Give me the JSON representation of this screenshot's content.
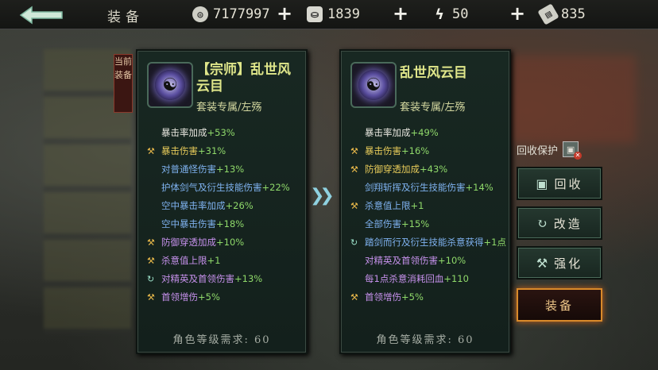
{
  "header": {
    "title": "装备",
    "resources": [
      {
        "icon": "coin-icon",
        "value": "7177997"
      },
      {
        "icon": "silver-ingot-icon",
        "value": "1839"
      },
      {
        "icon": "energy-icon",
        "value": "50"
      },
      {
        "icon": "ticket-icon",
        "value": "835"
      }
    ]
  },
  "current_tag": "当前装备",
  "left_panel": {
    "name": "【宗师】乱世风云目",
    "subtitle": "套装专属/左殇",
    "attributes": [
      {
        "label": "暴击率加成",
        "value": "+53%",
        "color": "white",
        "icon": ""
      },
      {
        "label": "暴击伤害",
        "value": "+31%",
        "color": "gold",
        "icon": "hammer-icon"
      },
      {
        "label": "对普通怪伤害",
        "value": "+13%",
        "color": "blue",
        "icon": ""
      },
      {
        "label": "护体剑气及衍生技能伤害",
        "value": "+22%",
        "color": "blue",
        "icon": ""
      },
      {
        "label": "空中暴击率加成",
        "value": "+26%",
        "color": "blue",
        "icon": ""
      },
      {
        "label": "空中暴击伤害",
        "value": "+18%",
        "color": "blue",
        "icon": ""
      },
      {
        "label": "防御穿透加成",
        "value": "+10%",
        "color": "purple",
        "icon": "hammer-icon"
      },
      {
        "label": "杀意值上限",
        "value": "+1",
        "color": "purple",
        "icon": "hammer-icon"
      },
      {
        "label": "对精英及首领伤害",
        "value": "+13%",
        "color": "purple",
        "icon": "refresh-icon"
      },
      {
        "label": "首领增伤",
        "value": "+5%",
        "color": "purple",
        "icon": "hammer-icon"
      }
    ],
    "requirement": "角色等级需求: 60"
  },
  "right_panel": {
    "name": "乱世风云目",
    "subtitle": "套装专属/左殇",
    "attributes": [
      {
        "label": "暴击率加成",
        "value": "+49%",
        "color": "white",
        "icon": ""
      },
      {
        "label": "暴击伤害",
        "value": "+16%",
        "color": "gold",
        "icon": "hammer-icon"
      },
      {
        "label": "防御穿透加成",
        "value": "+43%",
        "color": "gold",
        "icon": "hammer-icon"
      },
      {
        "label": "剑翔斩挥及衍生技能伤害",
        "value": "+14%",
        "color": "blue",
        "icon": ""
      },
      {
        "label": "杀意值上限",
        "value": "+1",
        "color": "blue",
        "icon": "hammer-icon"
      },
      {
        "label": "全部伤害",
        "value": "+15%",
        "color": "blue",
        "icon": ""
      },
      {
        "label": "踏剑而行及衍生技能杀意获得",
        "value": "+1点",
        "color": "blue",
        "icon": "refresh-icon",
        "wrap": true
      },
      {
        "label": "对精英及首领伤害",
        "value": "+10%",
        "color": "purple",
        "icon": ""
      },
      {
        "label": "每1点杀意消耗回血",
        "value": "+110",
        "color": "purple",
        "icon": ""
      },
      {
        "label": "首领增伤",
        "value": "+5%",
        "color": "purple",
        "icon": "hammer-icon"
      }
    ],
    "requirement": "角色等级需求: 60"
  },
  "actions": {
    "protect_label": "回收保护",
    "recycle": "回收",
    "reforge": "改造",
    "enhance": "强化",
    "equip": "装备"
  },
  "colors": {
    "white": "#e8e7df",
    "gold": "#e8cc5a",
    "blue": "#7fb2f0",
    "purple": "#c691ec",
    "value_green": "#8fd96a",
    "equip_border": "#d98a2a"
  }
}
